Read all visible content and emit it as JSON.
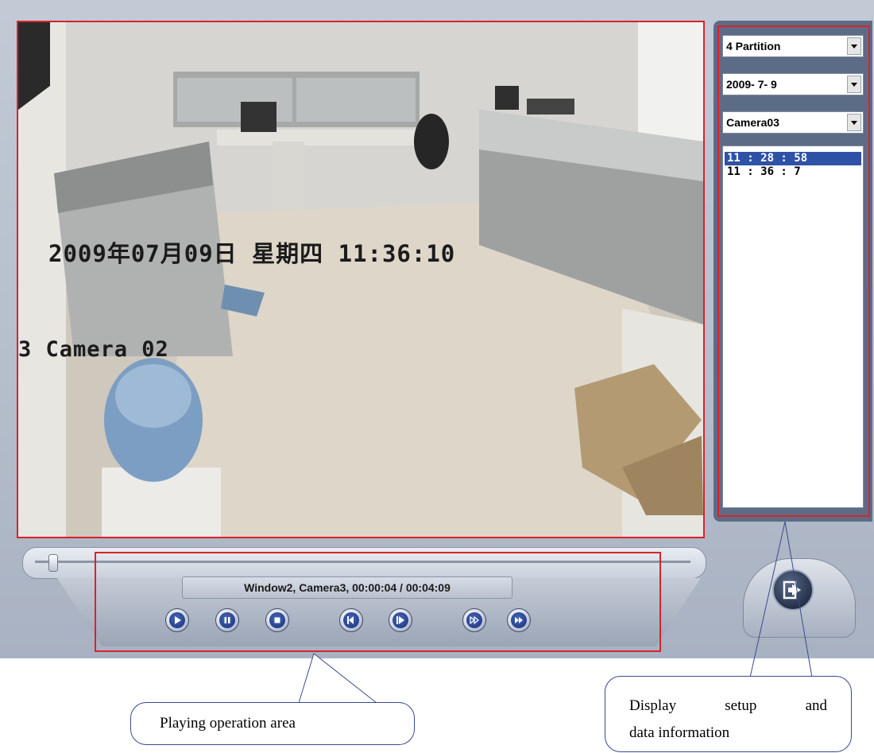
{
  "video": {
    "osd_datetime": "2009年07月09日 星期四 11:36:10",
    "osd_camera": "3 Camera 02"
  },
  "side_panel": {
    "partition_select": {
      "value": "4 Partition"
    },
    "date_select": {
      "value": "2009- 7- 9"
    },
    "camera_select": {
      "value": "Camera03"
    },
    "time_list": [
      {
        "label": "11 : 28 : 58",
        "selected": true
      },
      {
        "label": "11 : 36 : 7",
        "selected": false
      }
    ]
  },
  "playback": {
    "status": "Window2, Camera3, 00:00:04 / 00:04:09",
    "progress_fraction": 0.02,
    "buttons": [
      {
        "name": "play-button",
        "icon": "play-icon"
      },
      {
        "name": "pause-button",
        "icon": "pause-icon"
      },
      {
        "name": "stop-button",
        "icon": "stop-icon"
      },
      {
        "name": "step-back-button",
        "icon": "step-back-icon"
      },
      {
        "name": "step-forward-button",
        "icon": "step-forward-icon"
      },
      {
        "name": "fast-forward-button",
        "icon": "fast-forward-icon"
      },
      {
        "name": "skip-forward-button",
        "icon": "skip-forward-icon"
      }
    ]
  },
  "exit": {
    "icon": "exit-icon"
  },
  "callouts": {
    "playing_area": "Playing operation area",
    "display_setup_word1": "Display",
    "display_setup_word2": "setup",
    "display_setup_word3": "and",
    "display_setup_line2": "data information"
  },
  "colors": {
    "highlight_frame": "#d8232a",
    "list_selection": "#2e52a6",
    "button_blue": "#1f3a86",
    "callout_line": "#3b4a8c"
  }
}
